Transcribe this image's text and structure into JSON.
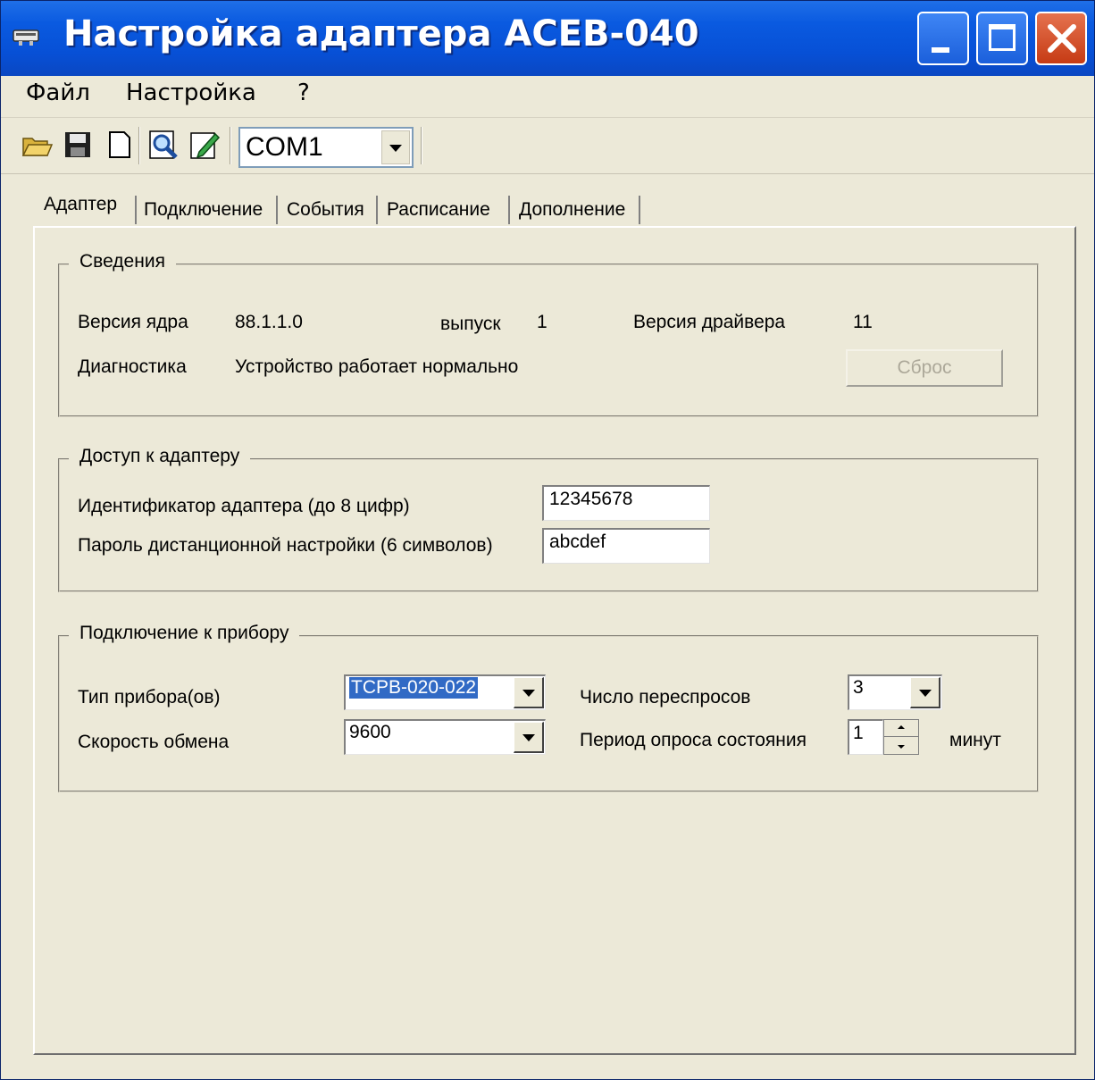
{
  "window": {
    "title": "Настройка адаптера АСЕВ-040"
  },
  "menu": {
    "items": [
      "Файл",
      "Настройка",
      "?"
    ]
  },
  "toolbar": {
    "icons": [
      "open-folder-icon",
      "save-icon",
      "new-document-icon",
      "search-icon",
      "edit-icon"
    ],
    "port_value": "COM1"
  },
  "tabs": [
    "Адаптер",
    "Подключение",
    "События",
    "Расписание",
    "Дополнение"
  ],
  "info": {
    "legend": "Сведения",
    "core_label": "Версия ядра",
    "core_value": "88.1.1.0",
    "release_label": "выпуск",
    "release_value": "1",
    "driver_label": "Версия драйвера",
    "driver_value": "11",
    "diag_label": "Диагностика",
    "diag_value": "Устройство работает нормально",
    "reset_label": "Сброс"
  },
  "access": {
    "legend": "Доступ к адаптеру",
    "id_label": "Идентификатор адаптера (до 8 цифр)",
    "id_value": "12345678",
    "pwd_label": "Пароль дистанционной настройки (6 символов)",
    "pwd_value": "abcdef"
  },
  "device": {
    "legend": "Подключение к прибору",
    "type_label": "Тип прибора(ов)",
    "type_value": "ТСРВ-020-022",
    "speed_label": "Скорость обмена",
    "speed_value": "9600",
    "retries_label": "Число переспросов",
    "retries_value": "3",
    "poll_label": "Период опроса состояния",
    "poll_value": "1",
    "poll_unit": "минут"
  }
}
